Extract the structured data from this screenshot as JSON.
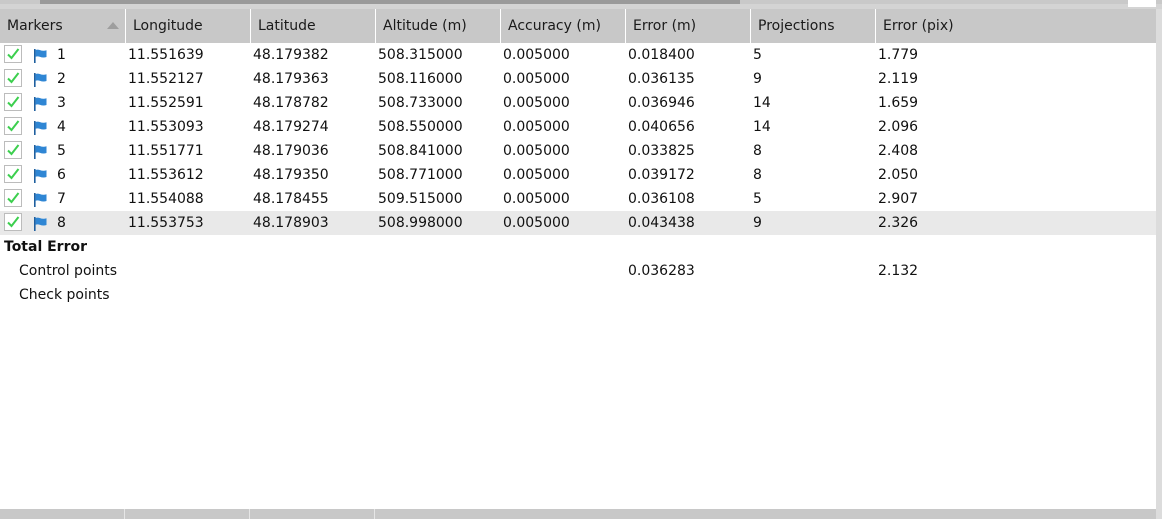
{
  "columns": [
    "Markers",
    "Longitude",
    "Latitude",
    "Altitude (m)",
    "Accuracy (m)",
    "Error (m)",
    "Projections",
    "Error (pix)"
  ],
  "rows": [
    {
      "id": "1",
      "checked": true,
      "longitude": "11.551639",
      "latitude": "48.179382",
      "altitude": "508.315000",
      "accuracy": "0.005000",
      "error_m": "0.018400",
      "projections": "5",
      "error_pix": "1.779"
    },
    {
      "id": "2",
      "checked": true,
      "longitude": "11.552127",
      "latitude": "48.179363",
      "altitude": "508.116000",
      "accuracy": "0.005000",
      "error_m": "0.036135",
      "projections": "9",
      "error_pix": "2.119"
    },
    {
      "id": "3",
      "checked": true,
      "longitude": "11.552591",
      "latitude": "48.178782",
      "altitude": "508.733000",
      "accuracy": "0.005000",
      "error_m": "0.036946",
      "projections": "14",
      "error_pix": "1.659"
    },
    {
      "id": "4",
      "checked": true,
      "longitude": "11.553093",
      "latitude": "48.179274",
      "altitude": "508.550000",
      "accuracy": "0.005000",
      "error_m": "0.040656",
      "projections": "14",
      "error_pix": "2.096"
    },
    {
      "id": "5",
      "checked": true,
      "longitude": "11.551771",
      "latitude": "48.179036",
      "altitude": "508.841000",
      "accuracy": "0.005000",
      "error_m": "0.033825",
      "projections": "8",
      "error_pix": "2.408"
    },
    {
      "id": "6",
      "checked": true,
      "longitude": "11.553612",
      "latitude": "48.179350",
      "altitude": "508.771000",
      "accuracy": "0.005000",
      "error_m": "0.039172",
      "projections": "8",
      "error_pix": "2.050"
    },
    {
      "id": "7",
      "checked": true,
      "longitude": "11.554088",
      "latitude": "48.178455",
      "altitude": "509.515000",
      "accuracy": "0.005000",
      "error_m": "0.036108",
      "projections": "5",
      "error_pix": "2.907"
    },
    {
      "id": "8",
      "checked": true,
      "longitude": "11.553753",
      "latitude": "48.178903",
      "altitude": "508.998000",
      "accuracy": "0.005000",
      "error_m": "0.043438",
      "projections": "9",
      "error_pix": "2.326",
      "selected": true
    }
  ],
  "total": {
    "title": "Total Error",
    "control": {
      "label": "Control points",
      "error_m": "0.036283",
      "error_pix": "2.132"
    },
    "check": {
      "label": "Check points",
      "error_m": "",
      "error_pix": ""
    }
  },
  "colors": {
    "check": "#3ccf4e",
    "flag": "#2f86d4",
    "selected_row": "#e9e9e9",
    "header": "#c8c8c8"
  },
  "icons": {
    "checkbox": "checkbox-checked-icon",
    "marker": "flag-icon",
    "sort": "sort-ascending-icon"
  }
}
